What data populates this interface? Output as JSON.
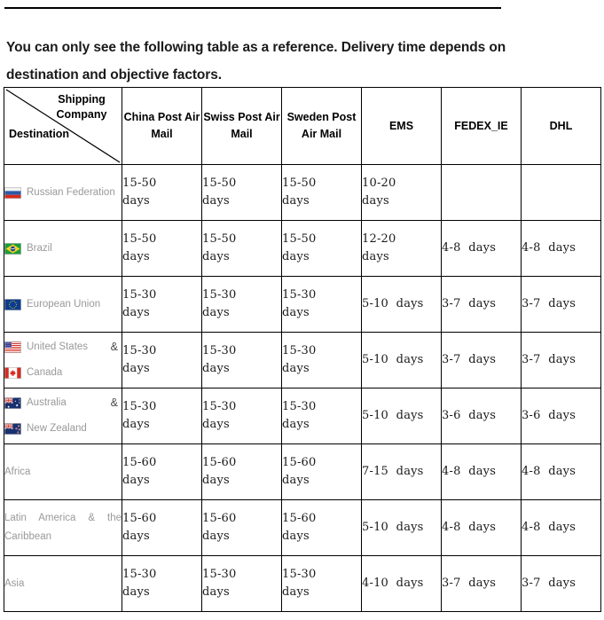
{
  "intro": {
    "text": "You can only see the following table as a reference. Delivery time depends on destination and objective factors."
  },
  "table": {
    "corner": {
      "shipping_label": "Shipping Company",
      "destination_label": "Destination"
    },
    "columns": [
      {
        "id": "china_post",
        "label": "China Post Air Mail"
      },
      {
        "id": "swiss_post",
        "label": "Swiss Post Air Mail"
      },
      {
        "id": "sweden_post",
        "label": "Sweden Post Air Mail"
      },
      {
        "id": "ems",
        "label": "EMS"
      },
      {
        "id": "fedex_ie",
        "label": "FEDEX_IE"
      },
      {
        "id": "dhl",
        "label": "DHL"
      }
    ],
    "rows": [
      {
        "destination": "Russian Federation",
        "destination_2": "",
        "ampersand": "",
        "flag": "russia",
        "flag_2": "",
        "china_post": "15-50 days",
        "swiss_post": "15-50 days",
        "sweden_post": "15-50 days",
        "ems": "10-20 days",
        "fedex_ie": "",
        "dhl": ""
      },
      {
        "destination": "Brazil",
        "destination_2": "",
        "ampersand": "",
        "flag": "brazil",
        "flag_2": "",
        "china_post": "15-50 days",
        "swiss_post": "15-50 days",
        "sweden_post": "15-50 days",
        "ems": "12-20 days",
        "fedex_ie": "4-8 days",
        "dhl": "4-8 days"
      },
      {
        "destination": "European Union",
        "destination_2": "",
        "ampersand": "",
        "flag": "eu",
        "flag_2": "",
        "china_post": "15-30 days",
        "swiss_post": "15-30 days",
        "sweden_post": "15-30 days",
        "ems": "5-10 days",
        "fedex_ie": "3-7 days",
        "dhl": "3-7 days"
      },
      {
        "destination": "United States",
        "destination_2": "Canada",
        "ampersand": "&",
        "flag": "usa",
        "flag_2": "canada",
        "china_post": "15-30 days",
        "swiss_post": "15-30 days",
        "sweden_post": "15-30 days",
        "ems": "5-10 days",
        "fedex_ie": "3-7 days",
        "dhl": "3-7 days"
      },
      {
        "destination": "Australia",
        "destination_2": "New Zealand",
        "ampersand": "&",
        "flag": "australia",
        "flag_2": "newzealand",
        "china_post": "15-30 days",
        "swiss_post": "15-30 days",
        "sweden_post": "15-30 days",
        "ems": "5-10 days",
        "fedex_ie": "3-6 days",
        "dhl": "3-6 days"
      },
      {
        "destination": "Africa",
        "destination_2": "",
        "ampersand": "",
        "flag": "",
        "flag_2": "",
        "china_post": "15-60 days",
        "swiss_post": "15-60 days",
        "sweden_post": "15-60 days",
        "ems": "7-15 days",
        "fedex_ie": "4-8 days",
        "dhl": "4-8 days"
      },
      {
        "destination": "Latin America & the Caribbean",
        "destination_2": "",
        "ampersand": "",
        "flag": "",
        "flag_2": "",
        "china_post": "15-60 days",
        "swiss_post": "15-60 days",
        "sweden_post": "15-60 days",
        "ems": "5-10 days",
        "fedex_ie": "4-8 days",
        "dhl": "4-8 days"
      },
      {
        "destination": "Asia",
        "destination_2": "",
        "ampersand": "",
        "flag": "",
        "flag_2": "",
        "china_post": "15-30 days",
        "swiss_post": "15-30 days",
        "sweden_post": "15-30 days",
        "ems": "4-10 days",
        "fedex_ie": "3-7 days",
        "dhl": "3-7 days"
      }
    ]
  },
  "colors": {
    "header_text": "#000000",
    "destination_text": "#999999",
    "value_text": "#1a1a1a",
    "border": "#000000",
    "background": "#ffffff"
  }
}
